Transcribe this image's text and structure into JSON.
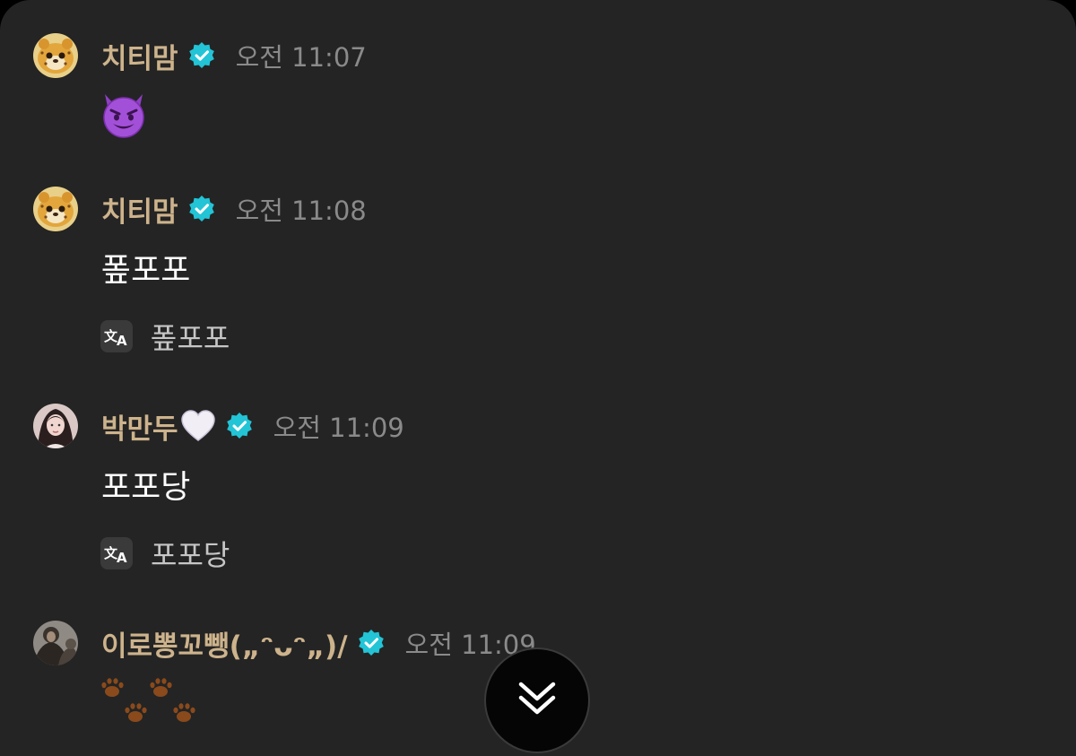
{
  "messages": [
    {
      "name": "치티맘",
      "time": "오전 11:07",
      "emoji": "smiling-devil-emoji"
    },
    {
      "name": "치티맘",
      "time": "오전 11:08",
      "text": "퐆포포",
      "translation": "퐆포포"
    },
    {
      "name": "박만두",
      "name_emoji": "white-heart-emoji",
      "time": "오전 11:09",
      "text": "포포당",
      "translation": "포포당"
    },
    {
      "name": "이로뽕꼬뺑(„ᵔᴗᵔ„)/",
      "time": "오전 11:09",
      "emoji": "paw-prints-emoji"
    }
  ],
  "icons": {
    "verified": "verified-badge-icon",
    "translate": "translate-icon",
    "scroll_down": "double-chevron-down-icon"
  },
  "colors": {
    "background": "#242424",
    "name": "#cdb38c",
    "time": "#8a8a8a",
    "verified": "#22c4d6",
    "message_text": "#ffffff",
    "translation_text": "#c6c6c6"
  }
}
